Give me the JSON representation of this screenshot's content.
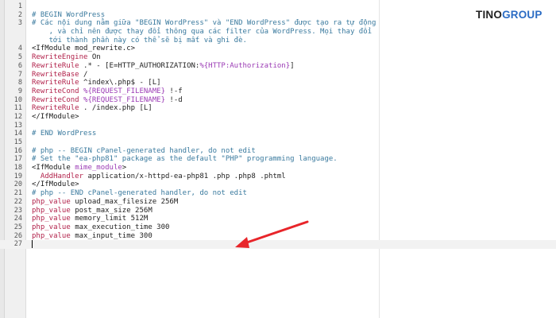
{
  "brand": {
    "name_part1": "TINO",
    "name_part2": "GROUP",
    "accent_color": "#2b6cc4"
  },
  "editor": {
    "lines": [
      {
        "num": "1",
        "segments": []
      },
      {
        "num": "2",
        "segments": [
          {
            "t": "# BEGIN WordPress",
            "c": "comment"
          }
        ]
      },
      {
        "num": "3",
        "segments": [
          {
            "t": "# Các nội dung nằm giữa \"BEGIN WordPress\" và \"END WordPress\" được tạo ra tự động",
            "c": "comment"
          }
        ]
      },
      {
        "num": "",
        "segments": [
          {
            "t": "    , và chỉ nên được thay đổi thông qua các filter của WordPress. Mọi thay đổi",
            "c": "comment"
          }
        ]
      },
      {
        "num": "",
        "segments": [
          {
            "t": "    tới thành phần này có thể sẽ bị mất và ghi đè.",
            "c": "comment"
          }
        ]
      },
      {
        "num": "4",
        "segments": [
          {
            "t": "<IfModule mod_rewrite.c>",
            "c": "tag"
          }
        ]
      },
      {
        "num": "5",
        "segments": [
          {
            "t": "RewriteEngine",
            "c": "dir"
          },
          {
            "t": " On",
            "c": "plain"
          }
        ]
      },
      {
        "num": "6",
        "segments": [
          {
            "t": "RewriteRule",
            "c": "dir"
          },
          {
            "t": " .* - [E=HTTP_AUTHORIZATION:",
            "c": "plain"
          },
          {
            "t": "%{HTTP:Authorization}",
            "c": "var"
          },
          {
            "t": "]",
            "c": "plain"
          }
        ]
      },
      {
        "num": "7",
        "segments": [
          {
            "t": "RewriteBase",
            "c": "dir"
          },
          {
            "t": " /",
            "c": "plain"
          }
        ]
      },
      {
        "num": "8",
        "segments": [
          {
            "t": "RewriteRule",
            "c": "dir"
          },
          {
            "t": " ^index\\.php$ - [L]",
            "c": "plain"
          }
        ]
      },
      {
        "num": "9",
        "segments": [
          {
            "t": "RewriteCond",
            "c": "dir"
          },
          {
            "t": " ",
            "c": "plain"
          },
          {
            "t": "%{REQUEST_FILENAME}",
            "c": "var"
          },
          {
            "t": " !-f",
            "c": "plain"
          }
        ]
      },
      {
        "num": "10",
        "segments": [
          {
            "t": "RewriteCond",
            "c": "dir"
          },
          {
            "t": " ",
            "c": "plain"
          },
          {
            "t": "%{REQUEST_FILENAME}",
            "c": "var"
          },
          {
            "t": " !-d",
            "c": "plain"
          }
        ]
      },
      {
        "num": "11",
        "segments": [
          {
            "t": "RewriteRule",
            "c": "dir"
          },
          {
            "t": " . /index.php [L]",
            "c": "plain"
          }
        ]
      },
      {
        "num": "12",
        "segments": [
          {
            "t": "</IfModule>",
            "c": "tag"
          }
        ]
      },
      {
        "num": "13",
        "segments": []
      },
      {
        "num": "14",
        "segments": [
          {
            "t": "# END WordPress",
            "c": "comment"
          }
        ]
      },
      {
        "num": "15",
        "segments": []
      },
      {
        "num": "16",
        "segments": [
          {
            "t": "# php -- BEGIN cPanel-generated handler, do not edit",
            "c": "comment"
          }
        ]
      },
      {
        "num": "17",
        "segments": [
          {
            "t": "# Set the \"ea-php81\" package as the default \"PHP\" programming language.",
            "c": "comment"
          }
        ]
      },
      {
        "num": "18",
        "segments": [
          {
            "t": "<IfModule ",
            "c": "tag"
          },
          {
            "t": "mime_module",
            "c": "var"
          },
          {
            "t": ">",
            "c": "tag"
          }
        ]
      },
      {
        "num": "19",
        "segments": [
          {
            "t": "  AddHandler",
            "c": "dir"
          },
          {
            "t": " application/x-httpd-ea-php81 .php .php8 .phtml",
            "c": "plain"
          }
        ]
      },
      {
        "num": "20",
        "segments": [
          {
            "t": "</IfModule>",
            "c": "tag"
          }
        ]
      },
      {
        "num": "21",
        "segments": [
          {
            "t": "# php -- END cPanel-generated handler, do not edit",
            "c": "comment"
          }
        ]
      },
      {
        "num": "22",
        "segments": [
          {
            "t": "php_value",
            "c": "dir"
          },
          {
            "t": " upload_max_filesize 256M",
            "c": "plain"
          }
        ]
      },
      {
        "num": "23",
        "segments": [
          {
            "t": "php_value",
            "c": "dir"
          },
          {
            "t": " post_max_size 256M",
            "c": "plain"
          }
        ]
      },
      {
        "num": "24",
        "segments": [
          {
            "t": "php_value",
            "c": "dir"
          },
          {
            "t": " memory_limit 512M",
            "c": "plain"
          }
        ]
      },
      {
        "num": "25",
        "segments": [
          {
            "t": "php_value",
            "c": "dir"
          },
          {
            "t": " max_execution_time 300",
            "c": "plain"
          }
        ]
      },
      {
        "num": "26",
        "segments": [
          {
            "t": "php_value",
            "c": "dir"
          },
          {
            "t": " max_input_time 300",
            "c": "plain"
          }
        ]
      },
      {
        "num": "27",
        "segments": [],
        "active": true,
        "cursor": true
      }
    ]
  },
  "annotation": {
    "arrow_color": "#e8252a",
    "arrow_icon": "red-arrow-icon"
  }
}
